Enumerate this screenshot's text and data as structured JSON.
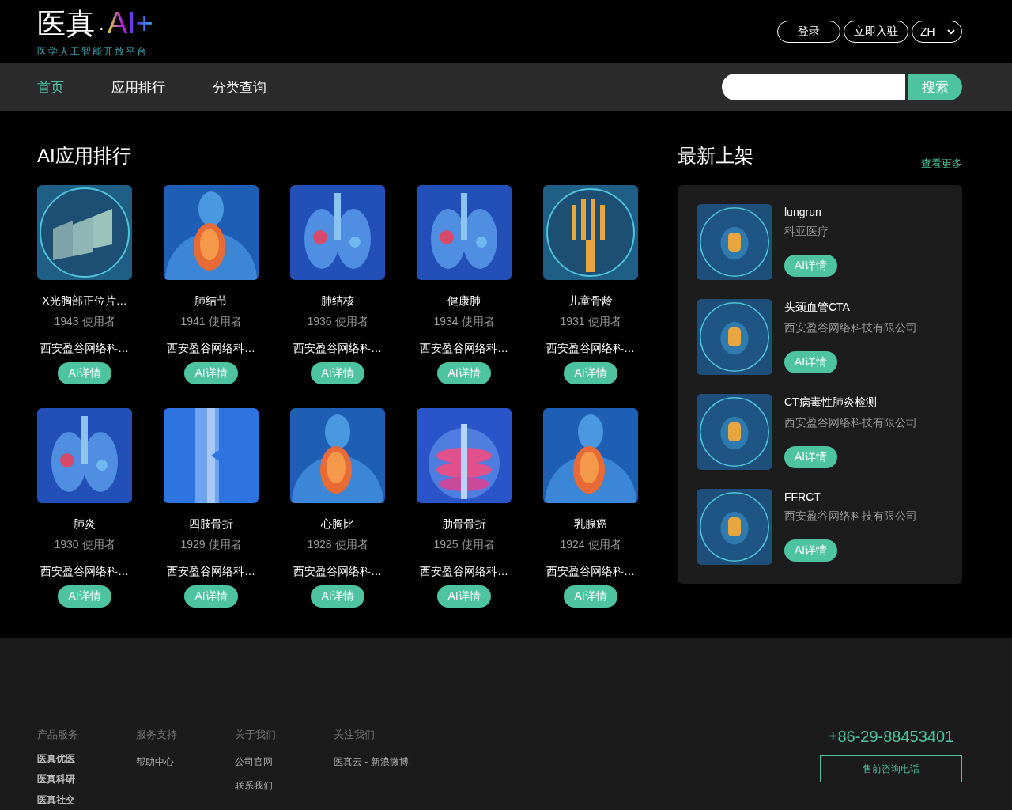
{
  "header": {
    "logo": {
      "main": "医真",
      "dot": "·",
      "ai": "AI+",
      "subtitle": "医学人工智能开放平台"
    },
    "buttons": [
      "登录",
      "立即入驻"
    ],
    "language": "ZH"
  },
  "nav": {
    "items": [
      {
        "label": "首页",
        "selected": true
      },
      {
        "label": "应用排行",
        "selected": false
      },
      {
        "label": "分类查询",
        "selected": false
      }
    ],
    "search_button": "搜索"
  },
  "ranking": {
    "title": "AI应用排行",
    "apps": [
      {
        "name": "X光胸部正位片…",
        "users": "1943 使用者",
        "company": "西安盈谷网络科…",
        "button": "AI详情",
        "kind": "picture"
      },
      {
        "name": "肺结节",
        "users": "1941 使用者",
        "company": "西安盈谷网络科…",
        "button": "AI详情",
        "kind": "picture"
      },
      {
        "name": "肺结核",
        "users": "1936 使用者",
        "company": "西安盈谷网络科…",
        "button": "AI详情",
        "kind": "picture"
      },
      {
        "name": "健康肺",
        "users": "1934 使用者",
        "company": "西安盈谷网络科…",
        "button": "AI详情",
        "kind": "picture"
      },
      {
        "name": "儿童骨龄",
        "users": "1931 使用者",
        "company": "西安盈谷网络科…",
        "button": "AI详情",
        "kind": "picture"
      },
      {
        "name": "肺炎",
        "users": "1930 使用者",
        "company": "西安盈谷网络科…",
        "button": "AI详情",
        "kind": "picture"
      },
      {
        "name": "四肢骨折",
        "users": "1929 使用者",
        "company": "西安盈谷网络科…",
        "button": "AI详情",
        "kind": "picture"
      },
      {
        "name": "心胸比",
        "users": "1928 使用者",
        "company": "西安盈谷网络科…",
        "button": "AI详情",
        "kind": "picture"
      },
      {
        "name": "肋骨骨折",
        "users": "1925 使用者",
        "company": "西安盈谷网络科…",
        "button": "AI详情",
        "kind": "picture"
      },
      {
        "name": "乳腺癌",
        "users": "1924 使用者",
        "company": "西安盈谷网络科…",
        "button": "AI详情",
        "kind": "picture"
      }
    ]
  },
  "latest": {
    "title": "最新上架",
    "more_link": "查看更多",
    "apps": [
      {
        "name": "lungrun",
        "company": "科亚医疗",
        "button": "AI详情",
        "kind": "picture"
      },
      {
        "name": "头颈血管CTA",
        "company": "西安盈谷网络科技有限公司",
        "button": "AI详情",
        "kind": "picture"
      },
      {
        "name": "CT病毒性肺炎检测",
        "company": "西安盈谷网络科技有限公司",
        "button": "AI详情",
        "kind": "picture"
      },
      {
        "name": "FFRCT",
        "company": "西安盈谷网络科技有限公司",
        "button": "AI详情",
        "kind": "picture"
      }
    ]
  },
  "footer": {
    "columns": [
      {
        "heading": "产品服务",
        "links": [
          "医真优医",
          "医真科研",
          "医真社交"
        ]
      },
      {
        "heading": "服务支持",
        "links": [
          "帮助中心"
        ]
      },
      {
        "heading": "关于我们",
        "links": [
          "公司官网",
          "联系我们"
        ]
      },
      {
        "heading": "关注我们",
        "links": [
          "医真云 - 新浪微博"
        ]
      }
    ],
    "phone": "+86-29-88453401",
    "phone_button": "售前咨询电话"
  }
}
